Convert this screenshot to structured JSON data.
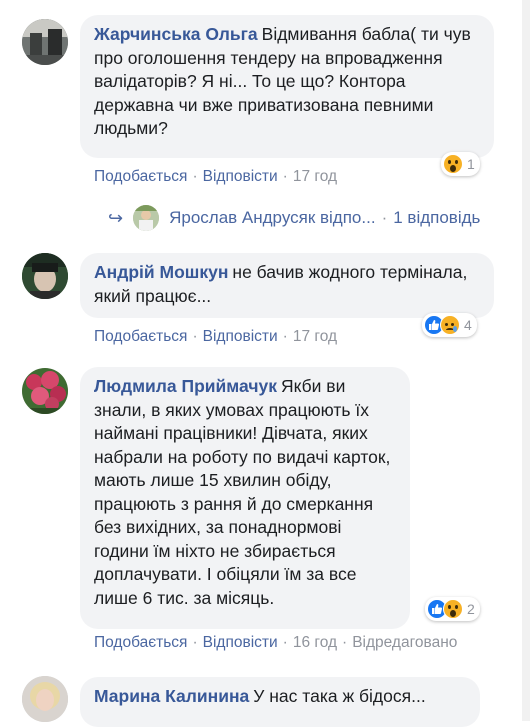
{
  "comments": [
    {
      "author": "Жарчинська Ольга",
      "text": "Відмивання бабла( ти чув про оголошення тендеру на впровадження валідаторів? Я ні... То це що? Контора державна чи вже приватизована певними людьми?",
      "actions": {
        "like": "Подобається",
        "reply": "Відповісти",
        "time": "17 год"
      },
      "reactions": {
        "icons": [
          "wow-icon"
        ],
        "count": "1"
      },
      "replies": {
        "author": "Ярослав Андрусяк",
        "label": "Ярослав Андрусяк відпо...",
        "count_label": "1 відповідь"
      }
    },
    {
      "author": "Андрій Мошкун",
      "text": "не бачив жодного термінала, який працює...",
      "actions": {
        "like": "Подобається",
        "reply": "Відповісти",
        "time": "17 год"
      },
      "reactions": {
        "icons": [
          "like-icon",
          "sad-icon"
        ],
        "count": "4"
      }
    },
    {
      "author": "Людмила Приймачук",
      "text": "Якби ви знали, в яких умовах працюють їх наймані працівники! Дівчата, яких набрали на роботу по видачі карток, мають лише 15 хвилин обіду, працюють з рання й до смеркання без вихідних, за понаднормові години їм ніхто не збирається доплачувати. І обіцяли їм за все лише 6 тис. за місяць.",
      "actions": {
        "like": "Подобається",
        "reply": "Відповісти",
        "time": "16 год",
        "edited": "Відредаговано"
      },
      "reactions": {
        "icons": [
          "like-icon",
          "wow-icon"
        ],
        "count": "2"
      }
    },
    {
      "author": "Марина Калинина",
      "text": "У нас така ж бідося..."
    }
  ],
  "separator": "·",
  "colors": {
    "link": "#385898",
    "meta": "#90949c",
    "bubble": "#f2f3f5",
    "like_blue": "#1877f2",
    "emoji_yellow": "#f7b125"
  }
}
